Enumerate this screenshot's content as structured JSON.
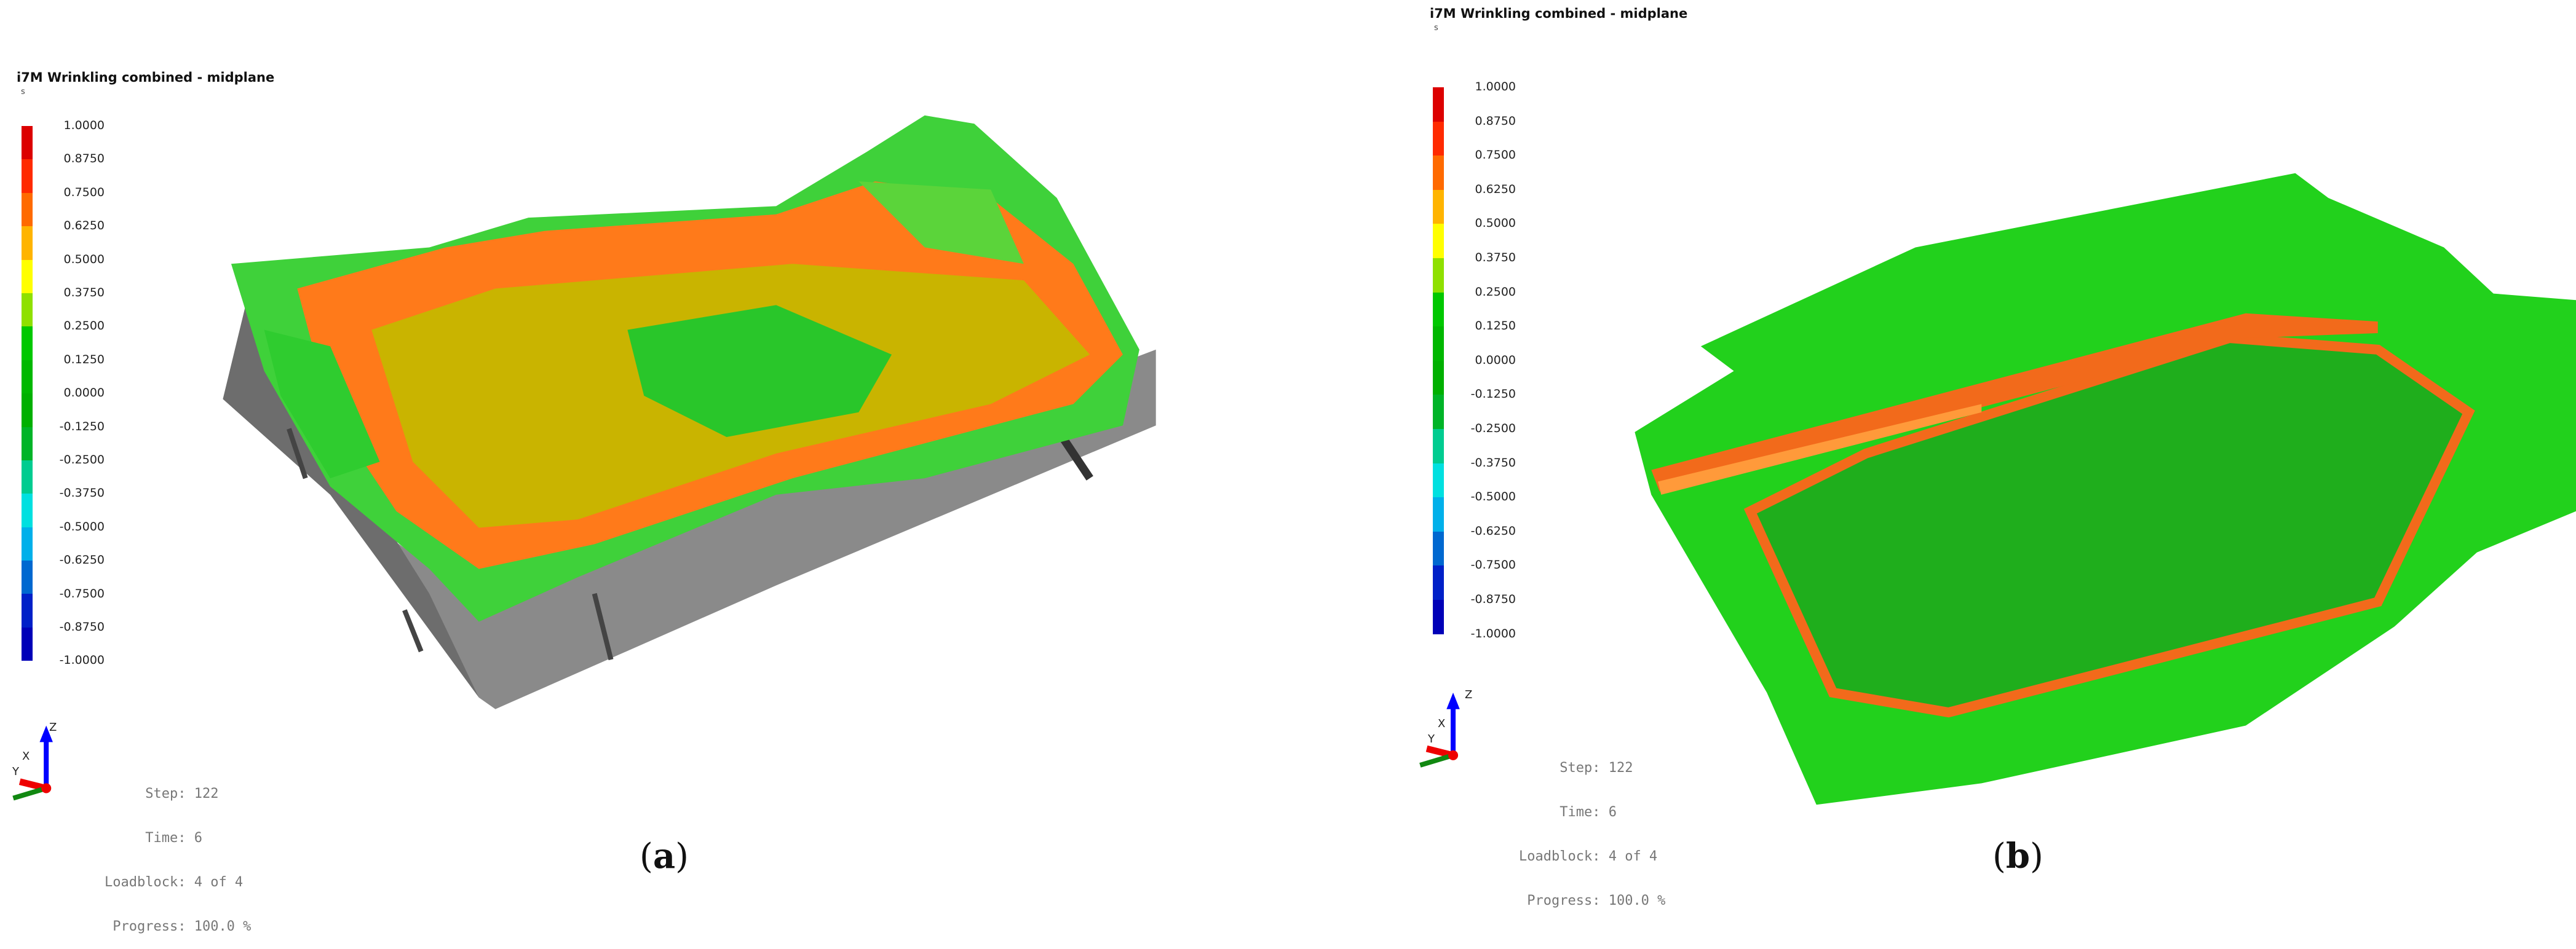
{
  "panels": [
    {
      "title": "i7M Wrinkling combined - midplane",
      "unit": "s",
      "legend_labels": [
        "1.0000",
        "0.8750",
        "0.7500",
        "0.6250",
        "0.5000",
        "0.3750",
        "0.2500",
        "0.1250",
        "0.0000",
        "-0.1250",
        "-0.2500",
        "-0.3750",
        "-0.5000",
        "-0.6250",
        "-0.7500",
        "-0.8750",
        "-1.0000"
      ],
      "info": {
        "step_label": "Step:",
        "step": "122",
        "time_label": "Time:",
        "time": "6",
        "loadblock_label": "Loadblock:",
        "loadblock": "4 of 4",
        "progress_label": "Progress:",
        "progress": "100.0 %"
      },
      "axes": {
        "x": "X",
        "y": "Y",
        "z": "Z"
      },
      "caption": "a"
    },
    {
      "title": "i7M Wrinkling combined - midplane",
      "unit": "s",
      "legend_labels": [
        "1.0000",
        "0.8750",
        "0.7500",
        "0.6250",
        "0.5000",
        "0.3750",
        "0.2500",
        "0.1250",
        "0.0000",
        "-0.1250",
        "-0.2500",
        "-0.3750",
        "-0.5000",
        "-0.6250",
        "-0.7500",
        "-0.8750",
        "-1.0000"
      ],
      "info": {
        "step_label": "Step:",
        "step": "122",
        "time_label": "Time:",
        "time": "6",
        "loadblock_label": "Loadblock:",
        "loadblock": "4 of 4",
        "progress_label": "Progress:",
        "progress": "100.0 %"
      },
      "axes": {
        "x": "X",
        "y": "Y",
        "z": "Z"
      },
      "caption": "b"
    }
  ],
  "legend_colors": [
    "#dc0000",
    "#ff2a00",
    "#ff6a00",
    "#ffb400",
    "#ffff00",
    "#8fe000",
    "#00c800",
    "#00b800",
    "#00b000",
    "#00b428",
    "#00cc90",
    "#00e0e0",
    "#00b0ea",
    "#0068d0",
    "#0020c8",
    "#0000b8"
  ]
}
